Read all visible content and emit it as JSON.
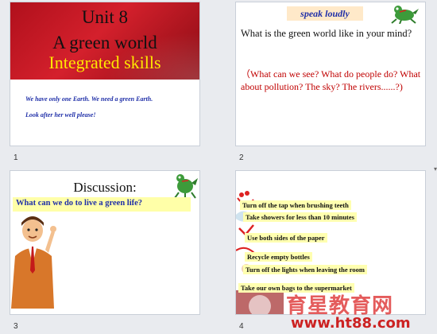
{
  "slides": [
    {
      "number": "1",
      "title_line1": "Unit 8",
      "title_line2": "A green world",
      "subtitle": "Integrated skills",
      "text_line1": "We have only one Earth. We need a green Earth.",
      "text_line2": "Look after her well please!"
    },
    {
      "number": "2",
      "header": "speak loudly",
      "question": "What is  the green world like in your mind?",
      "prompts": "（What can we see? What do people do? What about pollution? The sky? The rivers......?)"
    },
    {
      "number": "3",
      "title": "Discussion:",
      "question": "What  can we do to live a green life?"
    },
    {
      "number": "4",
      "tips": [
        "Turn off the tap when brushing teeth",
        "Take showers for less than 10 minutes",
        "Use both sides of the paper",
        "Recycle empty bottles",
        "Turn off the lights when leaving the room",
        "Take our own bags to the supermarket"
      ]
    }
  ],
  "watermark": {
    "brand": "育星教育网",
    "url": "www.ht88.com"
  },
  "colors": {
    "title_red": "#c4141e",
    "subtitle_yellow": "#ffe800",
    "body_blue": "#1f2fa8",
    "prompt_red": "#c00000",
    "highlight_yellow": "#ffffb0"
  },
  "icons": [
    "frog-mascot-icon",
    "teacher-illustration",
    "scissors-icon"
  ]
}
